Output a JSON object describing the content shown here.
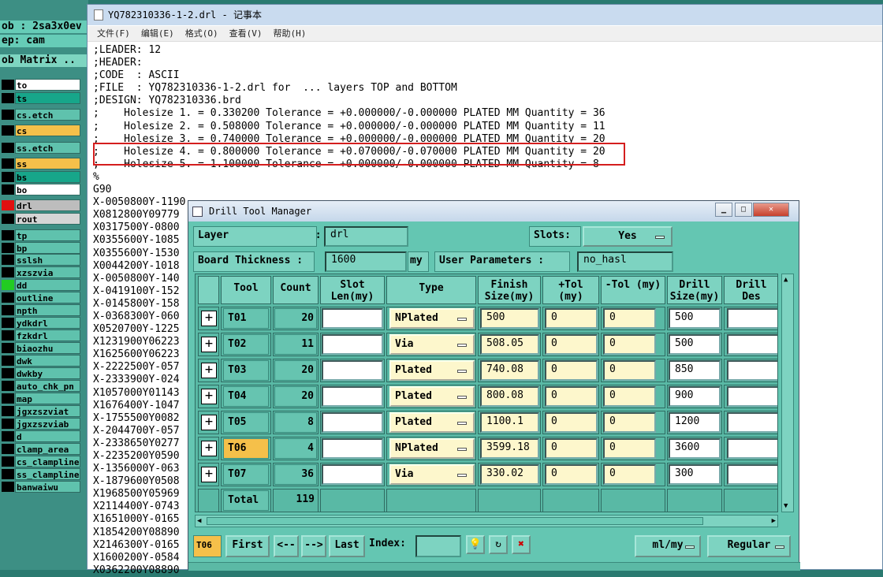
{
  "left_panel": {
    "job_line": "ob : 2sa3x0ev",
    "step_line": "ep: cam",
    "matrix_title": "ob Matrix ..",
    "layers": [
      {
        "name": "to",
        "bg": "#ffffff",
        "sw": "#000000"
      },
      {
        "name": "ts",
        "bg": "#17a68a",
        "sw": "#000000"
      },
      {
        "name": "cs.etch",
        "bg": "#5fc2ad",
        "sw": "#000000"
      },
      {
        "name": "cs",
        "bg": "#f5c04a",
        "sw": "#000000"
      },
      {
        "name": "ss.etch",
        "bg": "#5fc2ad",
        "sw": "#000000"
      },
      {
        "name": "ss",
        "bg": "#f5c04a",
        "sw": "#000000"
      },
      {
        "name": "bs",
        "bg": "#17a68a",
        "sw": "#000000"
      },
      {
        "name": "bo",
        "bg": "#ffffff",
        "sw": "#000000"
      },
      {
        "name": "drl",
        "bg": "#bdbdbd",
        "sw": "#e01010"
      },
      {
        "name": "rout",
        "bg": "#d5d5d5",
        "sw": "#000000"
      },
      {
        "name": "tp",
        "bg": "#5fc2ad",
        "sw": "#000000"
      },
      {
        "name": "bp",
        "bg": "#5fc2ad",
        "sw": "#000000"
      },
      {
        "name": "sslsh",
        "bg": "#5fc2ad",
        "sw": "#000000"
      },
      {
        "name": "xzszvia",
        "bg": "#5fc2ad",
        "sw": "#000000"
      },
      {
        "name": "dd",
        "bg": "#5fc2ad",
        "sw": "#22cc22"
      },
      {
        "name": "outline",
        "bg": "#5fc2ad",
        "sw": "#000000"
      },
      {
        "name": "npth",
        "bg": "#5fc2ad",
        "sw": "#000000"
      },
      {
        "name": "ydkdrl",
        "bg": "#5fc2ad",
        "sw": "#000000"
      },
      {
        "name": "fzkdrl",
        "bg": "#5fc2ad",
        "sw": "#000000"
      },
      {
        "name": "biaozhu",
        "bg": "#5fc2ad",
        "sw": "#000000"
      },
      {
        "name": "dwk",
        "bg": "#5fc2ad",
        "sw": "#000000"
      },
      {
        "name": "dwkby",
        "bg": "#5fc2ad",
        "sw": "#000000"
      },
      {
        "name": "auto_chk_pn",
        "bg": "#5fc2ad",
        "sw": "#000000"
      },
      {
        "name": "map",
        "bg": "#5fc2ad",
        "sw": "#000000"
      },
      {
        "name": "jgxzszviat",
        "bg": "#5fc2ad",
        "sw": "#000000"
      },
      {
        "name": "jgxzszviab",
        "bg": "#5fc2ad",
        "sw": "#000000"
      },
      {
        "name": "d",
        "bg": "#5fc2ad",
        "sw": "#000000"
      },
      {
        "name": "clamp_area",
        "bg": "#5fc2ad",
        "sw": "#000000"
      },
      {
        "name": "cs_clampline",
        "bg": "#5fc2ad",
        "sw": "#000000"
      },
      {
        "name": "ss_clampline",
        "bg": "#5fc2ad",
        "sw": "#000000"
      },
      {
        "name": "banwaiwu",
        "bg": "#5fc2ad",
        "sw": "#000000"
      }
    ]
  },
  "notepad": {
    "title": "YQ782310336-1-2.drl - 记事本",
    "menu": [
      "文件(F)",
      "编辑(E)",
      "格式(O)",
      "查看(V)",
      "帮助(H)"
    ],
    "lines": [
      ";LEADER: 12",
      ";HEADER:",
      ";CODE  : ASCII",
      ";FILE  : YQ782310336-1-2.drl for  ... layers TOP and BOTTOM",
      ";DESIGN: YQ782310336.brd",
      ";    Holesize 1. = 0.330200 Tolerance = +0.000000/-0.000000 PLATED MM Quantity = 36",
      ";    Holesize 2. = 0.508000 Tolerance = +0.000000/-0.000000 PLATED MM Quantity = 11",
      ";    Holesize 3. = 0.740000 Tolerance = +0.000000/-0.000000 PLATED MM Quantity = 20",
      ";    Holesize 4. = 0.800000 Tolerance = +0.070000/-0.070000 PLATED MM Quantity = 20",
      ";    Holesize 5. = 1.100000 Tolerance = +0.000000/-0.000000 PLATED MM Quantity = 8",
      "%",
      "G90",
      "X-0050800Y-1190",
      "X0812800Y09779",
      "X0317500Y-0800",
      "X0355600Y-1085",
      "X0355600Y-1530",
      "X0044200Y-1018",
      "X-0050800Y-140",
      "X-0419100Y-152",
      "X-0145800Y-158",
      "X-0368300Y-060",
      "X0520700Y-1225",
      "X1231900Y06223",
      "X1625600Y06223",
      "X-2222500Y-057",
      "X-2333900Y-024",
      "X1057000Y01143",
      "X1676400Y-1047",
      "X-1755500Y0082",
      "X-2044700Y-057",
      "X-2338650Y0277",
      "X-2235200Y0590",
      "X-1356000Y-063",
      "X-1879600Y0508",
      "X1968500Y05969",
      "X2114400Y-0743",
      "X1651000Y-0165",
      "X1854200Y08890",
      "X2146300Y-0165",
      "X1600200Y-0584",
      "X0362200Y08890"
    ]
  },
  "dialog": {
    "title": "Drill Tool Manager",
    "layer_label": "Layer              :",
    "layer_value": "drl",
    "slots_label": "Slots:",
    "slots_value": "Yes",
    "board_thickness_label": "Board Thickness :",
    "board_thickness_value": "1600",
    "board_thickness_unit": "my",
    "user_params_label": "User Parameters :",
    "user_params_value": "no_hasl",
    "columns": [
      "Tool",
      "Count",
      "Slot Len(my)",
      "Type",
      "Finish Size(my)",
      "+Tol (my)",
      "-Tol (my)",
      "Drill Size(my)",
      "Drill Des"
    ],
    "rows": [
      {
        "tool": "T01",
        "count": "20",
        "slot": "",
        "type": "NPlated",
        "finish": "500",
        "ptol": "0",
        "ntol": "0",
        "drill": "500",
        "des": ""
      },
      {
        "tool": "T02",
        "count": "11",
        "slot": "",
        "type": "Via",
        "finish": "508.05",
        "ptol": "0",
        "ntol": "0",
        "drill": "500",
        "des": ""
      },
      {
        "tool": "T03",
        "count": "20",
        "slot": "",
        "type": "Plated",
        "finish": "740.08",
        "ptol": "0",
        "ntol": "0",
        "drill": "850",
        "des": ""
      },
      {
        "tool": "T04",
        "count": "20",
        "slot": "",
        "type": "Plated",
        "finish": "800.08",
        "ptol": "0",
        "ntol": "0",
        "drill": "900",
        "des": ""
      },
      {
        "tool": "T05",
        "count": "8",
        "slot": "",
        "type": "Plated",
        "finish": "1100.1",
        "ptol": "0",
        "ntol": "0",
        "drill": "1200",
        "des": ""
      },
      {
        "tool": "T06",
        "count": "4",
        "slot": "",
        "type": "NPlated",
        "finish": "3599.18",
        "ptol": "0",
        "ntol": "0",
        "drill": "3600",
        "des": ""
      },
      {
        "tool": "T07",
        "count": "36",
        "slot": "",
        "type": "Via",
        "finish": "330.02",
        "ptol": "0",
        "ntol": "0",
        "drill": "300",
        "des": ""
      }
    ],
    "total_label": "Total",
    "total_count": "119",
    "current_tool": "T06",
    "nav": {
      "first": "First",
      "prev": "<--",
      "next": "-->",
      "last": "Last",
      "index_label": "Index:"
    },
    "units_value": "ml/my",
    "mode_value": "Regular"
  }
}
